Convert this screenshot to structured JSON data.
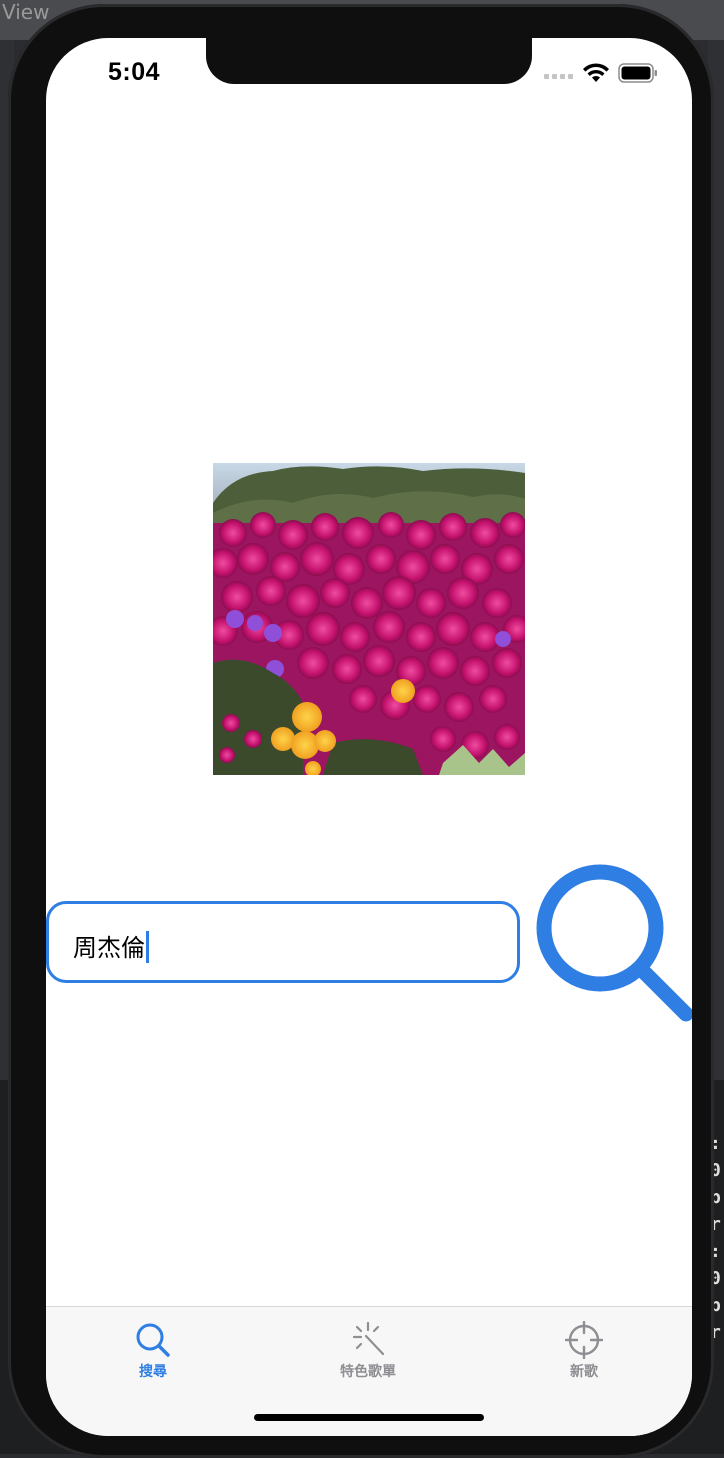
{
  "background": {
    "ide_tab_text": "View",
    "console_chars": [
      ":",
      "0",
      "b",
      "r",
      ":",
      "0",
      "b",
      "r"
    ]
  },
  "status_bar": {
    "time": "5:04"
  },
  "search": {
    "value": "周杰倫"
  },
  "tab_bar": {
    "tabs": [
      {
        "label": "搜尋",
        "icon": "search-icon",
        "selected": true
      },
      {
        "label": "特色歌單",
        "icon": "sparkle-icon",
        "selected": false
      },
      {
        "label": "新歌",
        "icon": "crosshair-icon",
        "selected": false
      }
    ]
  },
  "colors": {
    "accent": "#2f7ee3",
    "tab_inactive": "#8e8e93"
  }
}
